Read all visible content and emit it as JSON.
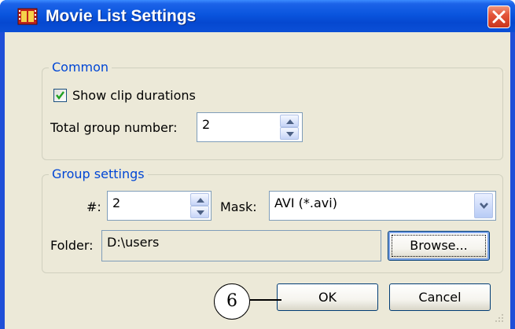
{
  "window": {
    "title": "Movie List Settings",
    "icon": "film-strip-icon",
    "close": "close-icon"
  },
  "common": {
    "legend": "Common",
    "show_durations": {
      "label": "Show clip durations",
      "checked": true
    },
    "total_group": {
      "label": "Total group number:",
      "value": "2"
    }
  },
  "group_settings": {
    "legend": "Group settings",
    "number": {
      "label": "#:",
      "value": "2"
    },
    "mask": {
      "label": "Mask:",
      "value": "AVI (*.avi)"
    },
    "folder": {
      "label": "Folder:",
      "value": "D:\\users"
    },
    "browse_label": "Browse..."
  },
  "buttons": {
    "ok": "OK",
    "cancel": "Cancel"
  },
  "callout": {
    "number": "6"
  },
  "colors": {
    "titlebar": "#0a55de",
    "dialog_bg": "#ece9d8",
    "group_legend": "#0046d5",
    "close_button": "#e4553a"
  }
}
